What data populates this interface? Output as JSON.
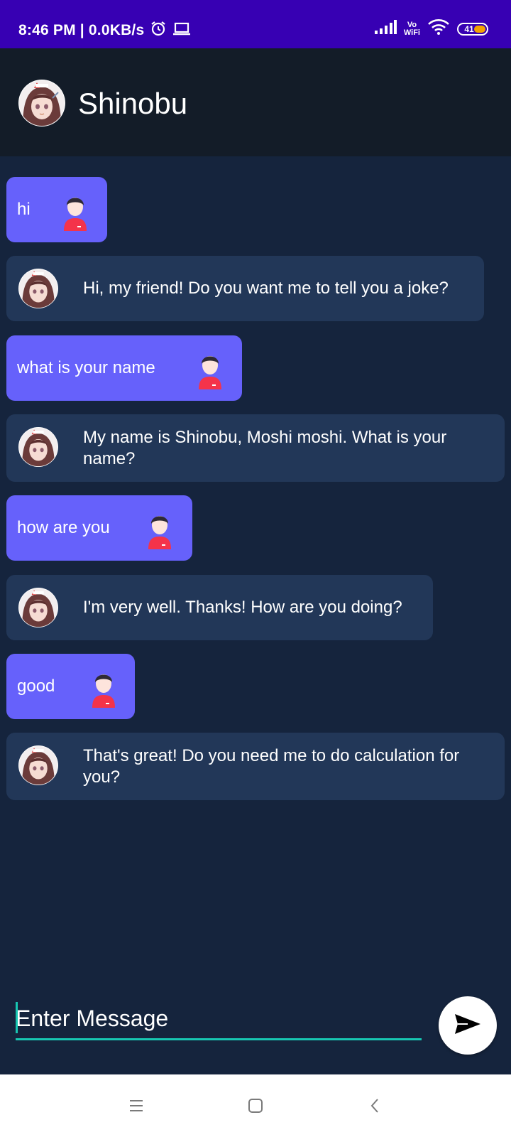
{
  "status_bar": {
    "time_speed": "8:46 PM | 0.0KB/s",
    "vowifi_top": "Vo",
    "vowifi_bottom": "WiFi",
    "battery_level": "41",
    "icons": [
      "alarm-icon",
      "laptop-icon",
      "signal-icon",
      "wifi-icon",
      "battery-icon"
    ]
  },
  "header": {
    "title": "Shinobu",
    "avatar_icon": "anime-girl-avatar"
  },
  "messages": [
    {
      "sender": "user",
      "text": "hi"
    },
    {
      "sender": "bot",
      "text": "Hi, my friend! Do you want me to tell you a joke?"
    },
    {
      "sender": "user",
      "text": "what is your name"
    },
    {
      "sender": "bot",
      "text": "My name is Shinobu, Moshi moshi. What is your name?"
    },
    {
      "sender": "user",
      "text": "how are you"
    },
    {
      "sender": "bot",
      "text": "I'm very well. Thanks! How are you doing?"
    },
    {
      "sender": "user",
      "text": "good"
    },
    {
      "sender": "bot",
      "text": "That's great! Do you need me to do calculation for you?"
    }
  ],
  "composer": {
    "placeholder": "Enter Message",
    "send_icon": "send-icon"
  },
  "nav_bar": {
    "icons": [
      "menu-icon",
      "home-icon",
      "back-icon"
    ]
  },
  "colors": {
    "status_bar": "#3700b3",
    "app_bar": "#131c28",
    "background": "#15243d",
    "user_bubble": "#6661fb",
    "bot_bubble": "#223758",
    "accent": "#17c7b2"
  }
}
